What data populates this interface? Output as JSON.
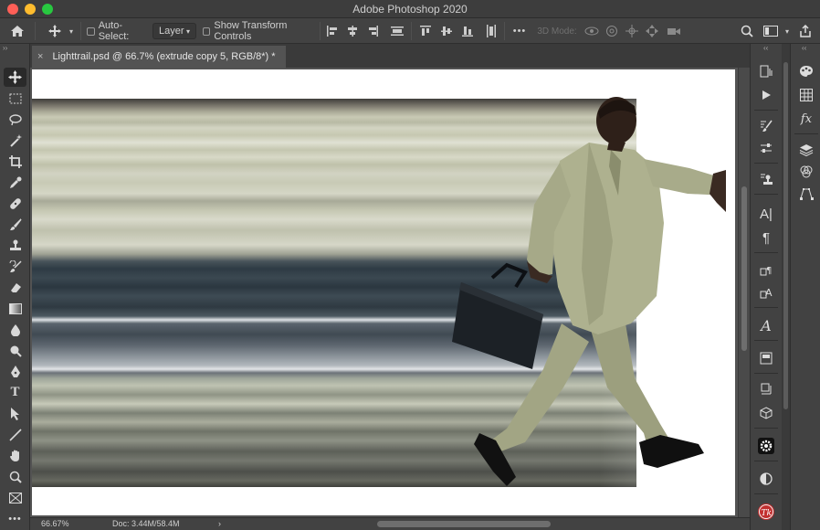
{
  "app": {
    "title": "Adobe Photoshop 2020"
  },
  "options_bar": {
    "auto_select_label": "Auto-Select:",
    "auto_select_value": "Layer",
    "show_transform_label": "Show Transform Controls",
    "more_label": "•••",
    "mode_3d_label": "3D Mode:"
  },
  "document": {
    "tab_title": "Lighttrail.psd @ 66.7% (extrude copy 5, RGB/8*) *",
    "close_glyph": "×"
  },
  "status": {
    "zoom": "66.67%",
    "doc_size": "Doc: 3.44M/58.4M",
    "arrow": "›"
  },
  "icons": {
    "left_toolbar": [
      "move-tool-icon",
      "marquee-tool-icon",
      "lasso-tool-icon",
      "magic-wand-icon",
      "crop-tool-icon",
      "eyedropper-icon",
      "healing-brush-icon",
      "brush-tool-icon",
      "clone-stamp-icon",
      "history-brush-icon",
      "eraser-icon",
      "gradient-icon",
      "blur-icon",
      "dodge-icon",
      "pen-tool-icon",
      "type-tool-icon",
      "path-selection-icon",
      "line-tool-icon",
      "hand-tool-icon",
      "zoom-tool-icon",
      "frame-tool-icon",
      "more-tools-icon"
    ]
  },
  "colors": {
    "accent_red": "#ff5f57",
    "accent_yellow": "#febc2e",
    "accent_green": "#28c840",
    "panel_bg": "#424242",
    "workspace_bg": "#535353"
  }
}
